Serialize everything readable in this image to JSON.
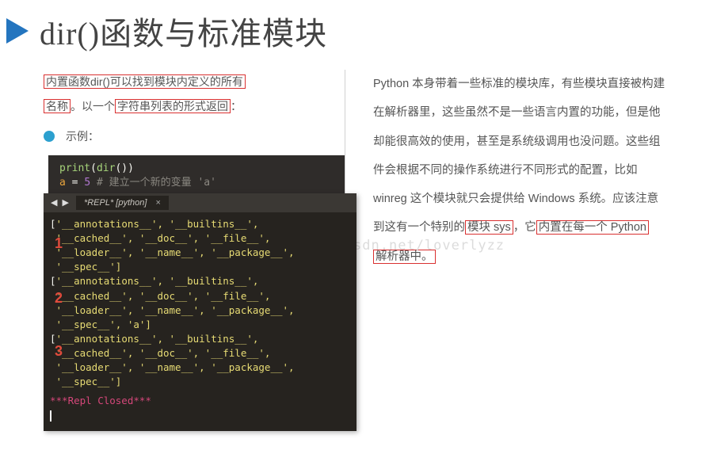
{
  "title": "dir()函数与标准模块",
  "definition": {
    "boxed1": "内置函数dir()可以找到模块内定义的所有",
    "boxed2": "名称",
    "mid": "。以一个",
    "boxed3": "字符串列表的形式返回",
    "tail": "："
  },
  "example_label": "示例：",
  "code_top": {
    "l1a": "print",
    "l1b": "(",
    "l1c": "dir",
    "l1d": "())",
    "l2a": "a",
    "l2b": " = ",
    "l2c": "5",
    "l2d": " # 建立一个新的变量 'a'"
  },
  "tab_label": "*REPL* [python]",
  "repl_lines": [
    "['__annotations__', '__builtins__',",
    " '__cached__', '__doc__', '__file__',",
    " '__loader__', '__name__', '__package__',",
    " '__spec__']",
    "['__annotations__', '__builtins__',",
    " '__cached__', '__doc__', '__file__',",
    " '__loader__', '__name__', '__package__',",
    " '__spec__', 'a']",
    "['__annotations__', '__builtins__',",
    " '__cached__', '__doc__', '__file__',",
    " '__loader__', '__name__', '__package__',",
    " '__spec__']"
  ],
  "repl_closed": "***Repl Closed***",
  "labels": {
    "n1": "1",
    "n2": "2",
    "n3": "3"
  },
  "paragraph": {
    "p1": "Python 本身带着一些标准的模块库，有些模块直接被构建在解析器里，这些虽然不是一些语言内置的功能，但是他却能很高效的使用，甚至是系统级调用也没问题。这些组件会根据不同的操作系统进行不同形式的配置，比如 winreg 这个模块就只会提供给 Windows 系统。应该注意到这有一个特别的",
    "box1": "模块 sys",
    "p2": "，它",
    "box2": "内置在每一个 Python",
    "box3": "解析器中。"
  },
  "watermark": "http://blog.csdn.net/loverlyzz"
}
